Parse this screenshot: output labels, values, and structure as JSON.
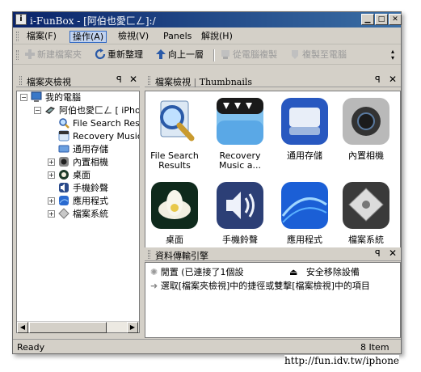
{
  "window": {
    "title": "i-FunBox - [阿伯也愛匚ㄥ]:/",
    "controls": [
      "minimize",
      "maximize",
      "close"
    ]
  },
  "menu": {
    "items": [
      {
        "label": "檔案(F)"
      },
      {
        "label": "操作(A)",
        "active": true
      },
      {
        "label": "檢視(V)"
      },
      {
        "label": "Panels"
      },
      {
        "label": "解說(H)"
      }
    ]
  },
  "toolbar": {
    "buttons": [
      {
        "label": "新建檔案夾",
        "icon": "add-icon",
        "enabled": false
      },
      {
        "label": "重新整理",
        "icon": "refresh-icon",
        "enabled": true
      },
      {
        "label": "向上一層",
        "icon": "up-arrow-icon",
        "enabled": true
      },
      {
        "label": "從電腦複製",
        "icon": "copy-from-pc-icon",
        "enabled": false
      },
      {
        "label": "複製至電腦",
        "icon": "copy-to-pc-icon",
        "enabled": false
      }
    ]
  },
  "folder_panel": {
    "title": "檔案夾檢視",
    "tree": [
      {
        "label": "我的電腦",
        "level": 0,
        "expander": "−",
        "icon": "computer-icon"
      },
      {
        "label": "阿伯也愛匚ㄥ [ iPhone ]",
        "level": 1,
        "expander": "−",
        "icon": "iphone-icon"
      },
      {
        "label": "File Search Results",
        "level": 2,
        "expander": "",
        "icon": "search-icon"
      },
      {
        "label": "Recovery Music",
        "level": 2,
        "expander": "",
        "icon": "music-icon"
      },
      {
        "label": "通用存儲",
        "level": 2,
        "expander": "",
        "icon": "storage-icon"
      },
      {
        "label": "內置相機",
        "level": 2,
        "expander": "+",
        "icon": "camera-icon"
      },
      {
        "label": "桌面",
        "level": 2,
        "expander": "+",
        "icon": "desktop-icon"
      },
      {
        "label": "手機鈴聲",
        "level": 2,
        "expander": "",
        "icon": "ringtone-icon"
      },
      {
        "label": "應用程式",
        "level": 2,
        "expander": "+",
        "icon": "apps-icon"
      },
      {
        "label": "檔案系統",
        "level": 2,
        "expander": "+",
        "icon": "filesystem-icon"
      }
    ]
  },
  "thumb_panel": {
    "title": "檔案檢視",
    "view_mode": "Thumbnails",
    "tiles": [
      {
        "label": "File Search Results",
        "icon": "search-icon"
      },
      {
        "label": "Recovery Music a...",
        "icon": "music-icon"
      },
      {
        "label": "通用存儲",
        "icon": "storage-icon"
      },
      {
        "label": "內置相機",
        "icon": "camera-icon"
      },
      {
        "label": "桌面",
        "icon": "lotus-icon"
      },
      {
        "label": "手機鈴聲",
        "icon": "speaker-icon"
      },
      {
        "label": "應用程式",
        "icon": "apps-icon"
      },
      {
        "label": "檔案系統",
        "icon": "filesystem-icon"
      }
    ]
  },
  "transfer_panel": {
    "title": "資料傳輸引擎",
    "rows": [
      {
        "left": "閒置 (已連接了1個設 ",
        "right": "安全移除設備"
      },
      {
        "text": "選取[檔案夾檢視]中的捷徑或雙擊[檔案檢視]中的項目"
      }
    ]
  },
  "status": {
    "left": "Ready",
    "right": "8 Item 剩"
  },
  "watermark": "http://fun.idv.tw/iphone",
  "colors": {
    "title_bar_start": "#0a246a",
    "title_bar_end": "#3a6ea5",
    "chrome": "#d4d0c8",
    "menu_active": "#c1d2ee"
  }
}
